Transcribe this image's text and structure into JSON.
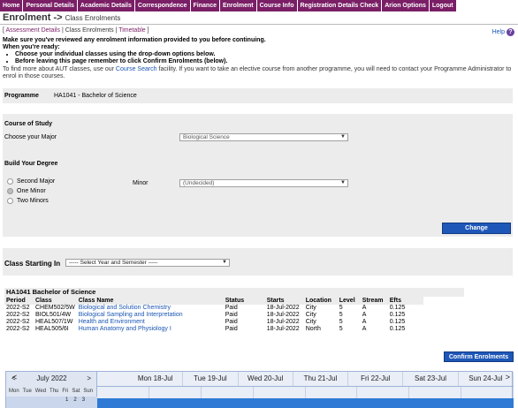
{
  "nav": [
    "Home",
    "Personal Details",
    "Academic Details",
    "Correspondence",
    "Finance",
    "Enrolment",
    "Course Info",
    "Registration Details Check",
    "Arion Options",
    "Logout"
  ],
  "header": {
    "title": "Enrolment",
    "arrow": "->",
    "subtitle": "Class Enrolments"
  },
  "help": {
    "label": "Help",
    "icon": "?"
  },
  "subnav": {
    "open": "[",
    "assessment": "Assessment Details",
    "sep1": "|",
    "current": "Class Enrolments",
    "sep2": "|",
    "timetable": "Timetable",
    "close": "]"
  },
  "info": {
    "line1": "Make sure you've reviewed any enrolment information provided to you before continuing.",
    "line2": "When you're ready:",
    "bullet1": "Choose your individual classes using the drop-down options below.",
    "bullet2": "Before leaving this page remember to click Confirm Enrolments (below).",
    "plain_pre": "To find more about AUT classes, use our",
    "plain_link": "Course Search",
    "plain_post": "facility. If you want to take an elective course from another programme, you will need to contact your Programme Administrator to enrol in those courses."
  },
  "programme": {
    "label": "Programme",
    "value": "HA1041 - Bachelor of Science"
  },
  "course_of_study": {
    "heading": "Course of Study",
    "major_label": "Choose your Major",
    "major_value": "Biological Science",
    "build_heading": "Build Your Degree",
    "options": [
      "Second Major",
      "One Minor",
      "Two Minors"
    ],
    "minor_label": "Minor",
    "minor_value": "(Undecided)",
    "change_button": "Change"
  },
  "class_starting": {
    "label": "Class Starting In",
    "value": "----- Select Year and Semester -----"
  },
  "enrolments": {
    "title": "HA1041 Bachelor of Science",
    "columns": [
      "Period",
      "Class",
      "Class Name",
      "Status",
      "Starts",
      "Location",
      "Level",
      "Stream",
      "Efts"
    ],
    "rows": [
      [
        "2022-S2",
        "CHEM502/5W",
        "Biological and Solution Chemistry",
        "Paid",
        "18-Jul-2022",
        "City",
        "5",
        "A",
        "0.125"
      ],
      [
        "2022-S2",
        "BIOL501/4W",
        "Biological Sampling and Interpretation",
        "Paid",
        "18-Jul-2022",
        "City",
        "5",
        "A",
        "0.125"
      ],
      [
        "2022-S2",
        "HEAL507/1W",
        "Health and Environment",
        "Paid",
        "18-Jul-2022",
        "City",
        "5",
        "A",
        "0.125"
      ],
      [
        "2022-S2",
        "HEAL505/6I",
        "Human Anatomy and Physiology I",
        "Paid",
        "18-Jul-2022",
        "North",
        "5",
        "A",
        "0.125"
      ]
    ]
  },
  "confirm_button": "Confirm Enrolments",
  "calendar": {
    "month": "July 2022",
    "prev": "<",
    "next": ">",
    "weekdays": [
      "Mon",
      "Tue",
      "Wed",
      "Thu",
      "Fri",
      "Sat",
      "Sun"
    ],
    "first_dates": [
      "1",
      "2",
      "3"
    ],
    "week_days": [
      "Mon 18-Jul",
      "Tue 19-Jul",
      "Wed 20-Jul",
      "Thu 21-Jul",
      "Fri 22-Jul",
      "Sat 23-Jul",
      "Sun 24-Jul"
    ]
  },
  "colors": {
    "nav": "#7a1f66",
    "button": "#1e57b8",
    "link": "#1a56b3",
    "panel": "#ececec",
    "calendar_bar": "#2e7ad4"
  }
}
